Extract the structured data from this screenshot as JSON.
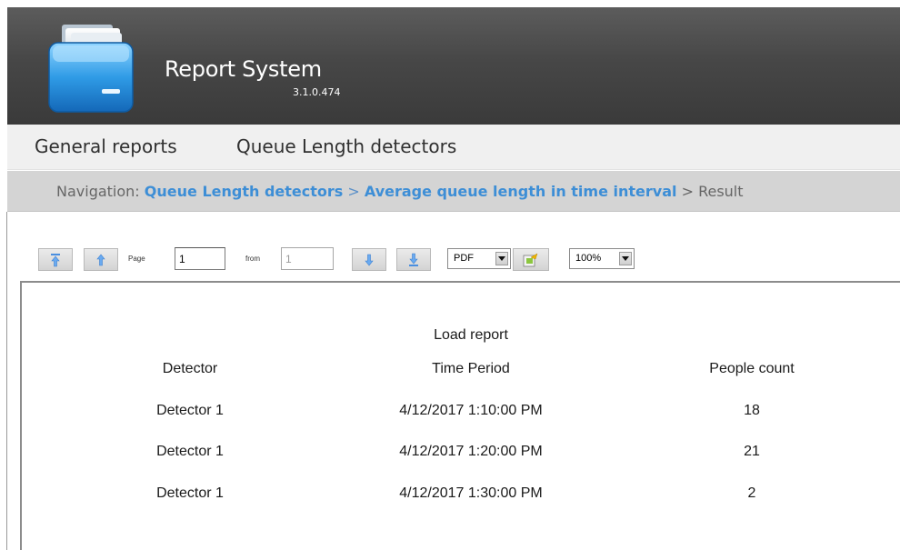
{
  "header": {
    "title": "Report System",
    "version": "3.1.0.474",
    "logo_icon": "folder-drawer-icon"
  },
  "menu": {
    "items": [
      "General reports",
      "Queue Length detectors"
    ]
  },
  "navigation": {
    "label": "Navigation:",
    "crumbs": [
      "Queue Length detectors",
      "Average queue length in time interval"
    ],
    "current": "Result",
    "separator": ">"
  },
  "toolbar": {
    "first_page_icon": "first-page-icon",
    "prev_page_icon": "previous-page-icon",
    "page_label": "Page",
    "page_value": "1",
    "from_label": "from",
    "from_value": "1",
    "next_page_icon": "next-page-icon",
    "last_page_icon": "last-page-icon",
    "format_value": "PDF",
    "export_icon": "export-icon",
    "zoom_value": "100%"
  },
  "report": {
    "title": "Load report",
    "columns": [
      "Detector",
      "Time Period",
      "People count"
    ],
    "rows": [
      [
        "Detector 1",
        "4/12/2017 1:10:00 PM",
        "18"
      ],
      [
        "Detector 1",
        "4/12/2017 1:20:00 PM",
        "21"
      ],
      [
        "Detector 1",
        "4/12/2017 1:30:00 PM",
        "2"
      ]
    ]
  },
  "colors": {
    "header_bg": "#474747",
    "link": "#3d8ed6",
    "nav_bg": "#d4d4d4",
    "menu_bg": "#f0f0f0"
  }
}
